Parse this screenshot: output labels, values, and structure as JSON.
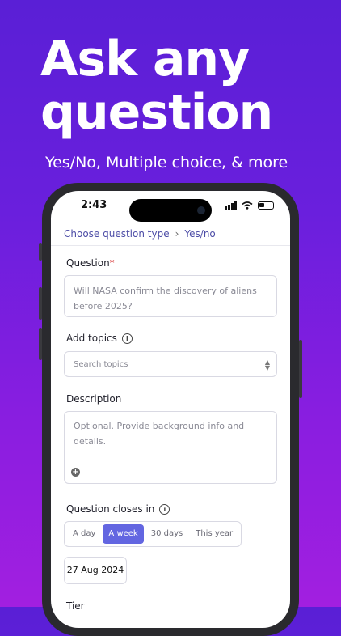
{
  "promo": {
    "headline_line1": "Ask any",
    "headline_line2": "question",
    "subheadline": "Yes/No, Multiple choice, & more"
  },
  "status_bar": {
    "time": "2:43"
  },
  "breadcrumb": {
    "parent": "Choose question type",
    "current": "Yes/no"
  },
  "form": {
    "question_label": "Question",
    "question_required_mark": "*",
    "question_placeholder_line1": "Will NASA confirm the discovery of aliens",
    "question_placeholder_line2": "before 2025?",
    "topics_label": "Add topics",
    "topics_placeholder": "Search topics",
    "description_label": "Description",
    "description_placeholder": "Optional. Provide background info and details.",
    "closes_label": "Question closes in",
    "closes_options": [
      "A day",
      "A week",
      "30 days",
      "This year"
    ],
    "closes_selected": "A week",
    "close_date": "27 Aug 2024",
    "tier_label": "Tier"
  },
  "colors": {
    "accent": "#6366e1",
    "breadcrumb": "#4c4ca6",
    "required": "#d93b3b"
  }
}
